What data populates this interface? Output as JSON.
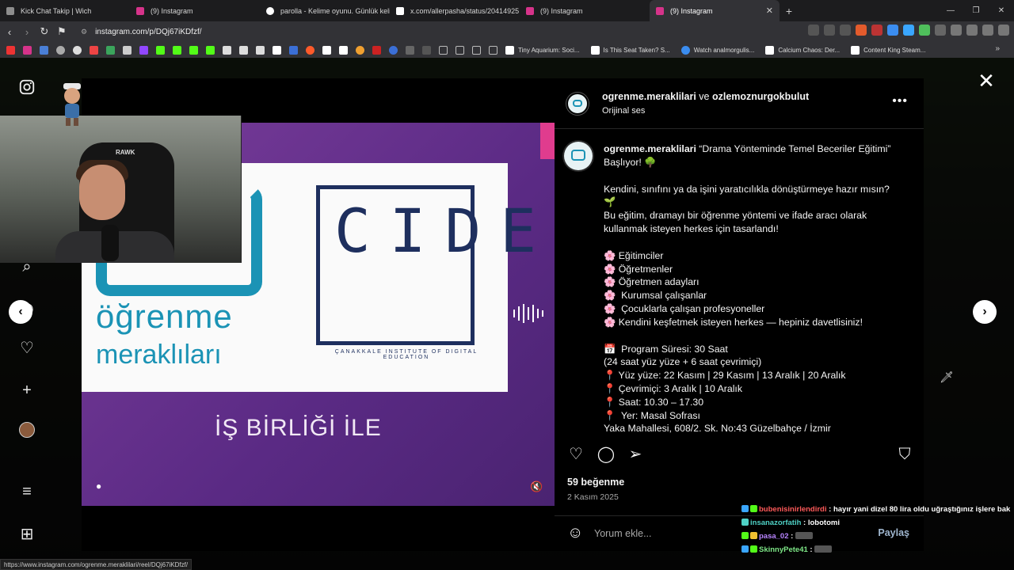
{
  "browser": {
    "tabs": [
      {
        "label": "Kick Chat Takip | Wich",
        "favicon_color": "#8d8d8d",
        "active": false
      },
      {
        "label": "(9) Instagram",
        "favicon_color": "#d6338a",
        "active": false
      },
      {
        "label": "parolla - Kelime oyunu. Günlük kelim",
        "favicon_color": "#ffffff",
        "active": false
      },
      {
        "label": "x.com/allerpasha/status/20414925",
        "favicon_color": "#ffffff",
        "active": false
      },
      {
        "label": "(9) Instagram",
        "favicon_color": "#d6338a",
        "active": false
      },
      {
        "label": "(9) Instagram",
        "favicon_color": "#d6338a",
        "active": true
      }
    ],
    "new_tab": "+",
    "url": "instagram.com/p/DQj67iKDfzf/",
    "bookmarks": [
      {
        "label": "Tiny Aquarium: Soci...",
        "color": "#ffffff"
      },
      {
        "label": "Is This Seat Taken? S...",
        "color": "#ffffff"
      },
      {
        "label": "Watch analmorgulis...",
        "color": "#3b8df0"
      },
      {
        "label": "Calcium Chaos: Der...",
        "color": "#ffffff"
      },
      {
        "label": "Content King Steam...",
        "color": "#ffffff"
      }
    ],
    "status_url": "https://www.instagram.com/ogrenme.meraklilari/reel/DQj67iKDfzf/"
  },
  "video": {
    "brand_line1": "öğrenme",
    "brand_line2": "meraklıları",
    "cide_letters": "CIDE",
    "cide_subtitle": "ÇANAKKALE INSTITUTE OF DIGITAL EDUCATION",
    "collab_text": "İŞ BİRLİĞİ İLE",
    "webcam_logo": "RAWK"
  },
  "post": {
    "author": "ogrenme.meraklilari",
    "connector": " ve ",
    "coauthor": "ozlemoznurgokbulut",
    "audio": "Orijinal ses",
    "caption_user": "ogrenme.meraklilari",
    "caption_lines": [
      " “Drama Yönteminde Temel Beceriler Eğitimi”",
      "Başlıyor! 🌳",
      "",
      "Kendini, sınıfını ya da işini yaratıcılıkla dönüştürmeye hazır mısın?",
      "🌱",
      "Bu eğitim, dramayı bir öğrenme yöntemi ve ifade aracı olarak",
      "kullanmak isteyen herkes için tasarlandı!",
      "",
      "🌸 Eğitimciler",
      "🌸 Öğretmenler",
      "🌸 Öğretmen adayları",
      "🌸  Kurumsal çalışanlar",
      "🌸  Çocuklarla çalışan profesyoneller",
      "🌸 Kendini keşfetmek isteyen herkes — hepiniz davetlisiniz!",
      "",
      "📅  Program Süresi: 30 Saat",
      "(24 saat yüz yüze + 6 saat çevrimiçi)",
      "📍 Yüz yüze: 22 Kasım | 29 Kasım | 13 Aralık | 20 Aralık",
      "📍 Çevrimiçi: 3 Aralık | 10 Aralık",
      "📍 Saat: 10.30 – 17.30",
      "📍  Yer: Masal Sofrası",
      "Yaka Mahallesi, 608/2. Sk. No:43 Güzelbahçe / İzmir"
    ],
    "likes": "59 beğenme",
    "date": "2 Kasım 2025",
    "comment_placeholder": "Yorum ekle...",
    "post_button": "Paylaş"
  },
  "chat": [
    {
      "user": "bubenisinirlendirdi",
      "user_color": "#ff5a5a",
      "message": "hayır yani dizel 80 lira oldu uğraştığınız işlere bak"
    },
    {
      "user": "insanazorfatih",
      "user_color": "#4fd1c5",
      "message": "lobotomi"
    },
    {
      "user": "pasa_02",
      "user_color": "#b884ff",
      "message": ""
    },
    {
      "user": "SkinnyPete41",
      "user_color": "#7ee787",
      "message": ""
    }
  ]
}
